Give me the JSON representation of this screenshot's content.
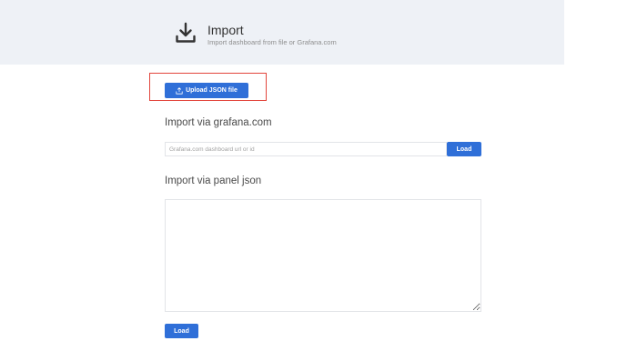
{
  "header": {
    "title": "Import",
    "subtitle": "Import dashboard from file or Grafana.com",
    "icon": "import-download-icon"
  },
  "upload": {
    "label": "Upload JSON file",
    "icon": "upload-icon",
    "highlight_color": "#e2453c"
  },
  "grafana_com": {
    "title": "Import via grafana.com",
    "input_placeholder": "Grafana.com dashboard url or id",
    "input_value": "",
    "load_label": "Load"
  },
  "panel_json": {
    "title": "Import via panel json",
    "textarea_value": "",
    "load_label": "Load"
  },
  "colors": {
    "primary": "#2f6fd8",
    "header_bg": "#eef1f6"
  }
}
